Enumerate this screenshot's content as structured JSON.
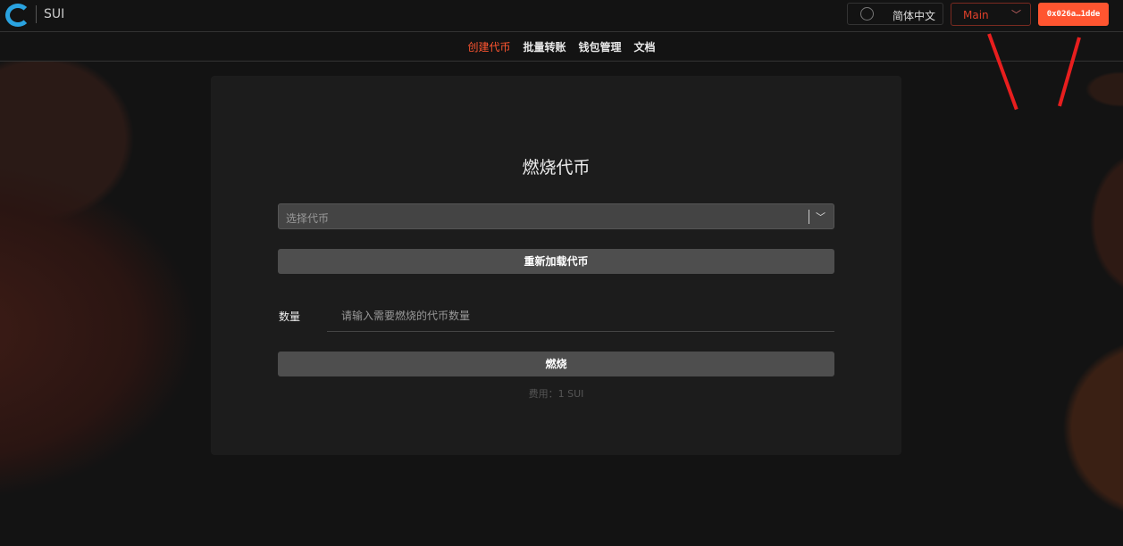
{
  "header": {
    "brand": "SUI",
    "language": "简体中文",
    "network": "Main",
    "wallet": "0x026a…1dde"
  },
  "nav": [
    "创建代币",
    "批量转账",
    "钱包管理",
    "文档"
  ],
  "form": {
    "title": "燃烧代币",
    "select_placeholder": "选择代币",
    "reload_label": "重新加载代币",
    "amount_label": "数量",
    "amount_placeholder": "请输入需要燃烧的代币数量",
    "burn_label": "燃烧",
    "fee": "费用：1 SUI"
  },
  "colors": {
    "accent": "#ff5530"
  }
}
